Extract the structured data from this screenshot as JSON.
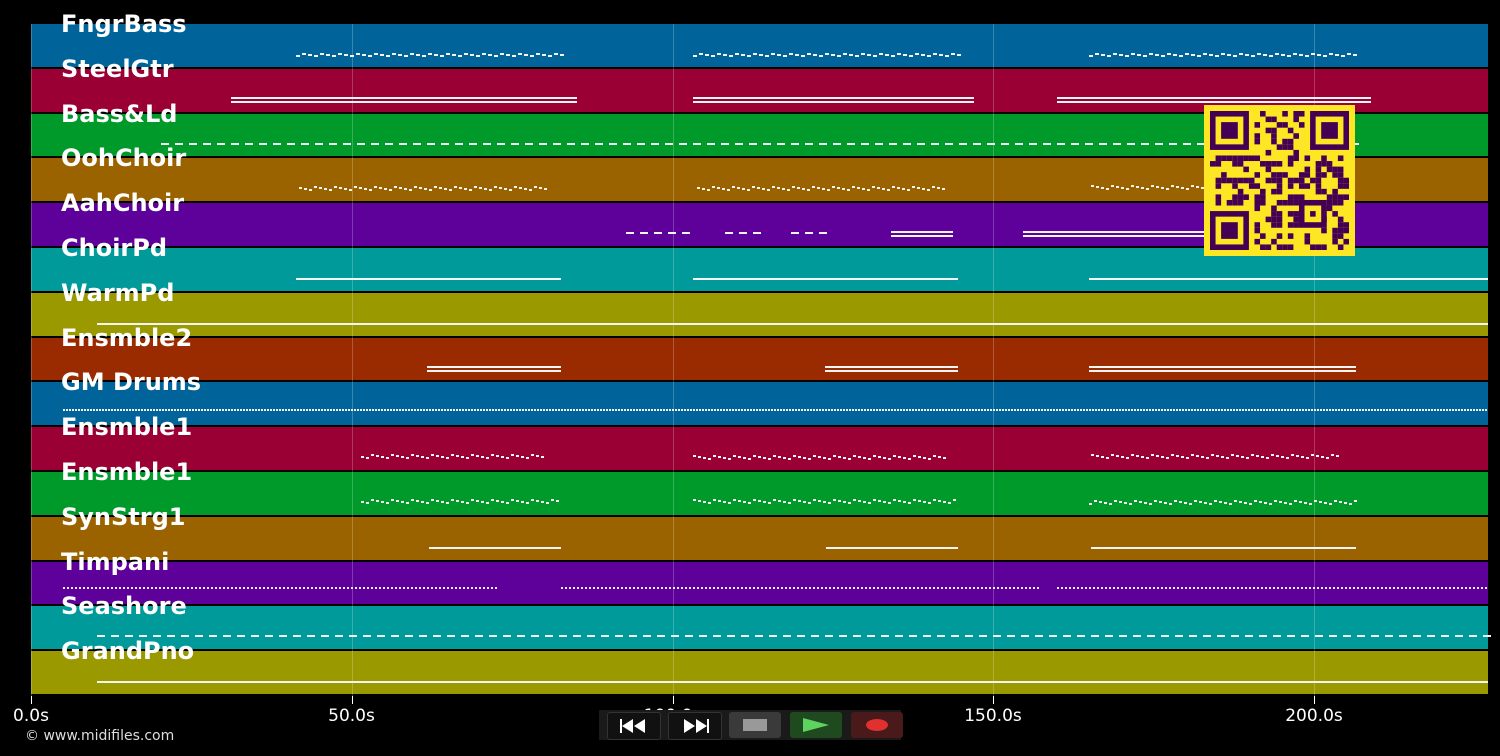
{
  "tracks": [
    {
      "name": "FngrBass",
      "color": "#00639a"
    },
    {
      "name": "SteelGtr",
      "color": "#9a0033"
    },
    {
      "name": "Bass&Ld",
      "color": "#009a2a"
    },
    {
      "name": "OohChoir",
      "color": "#9a6300"
    },
    {
      "name": "AahChoir",
      "color": "#5e009a"
    },
    {
      "name": "ChoirPd",
      "color": "#009a9a"
    },
    {
      "name": "WarmPd",
      "color": "#9a9a00"
    },
    {
      "name": "Ensmble2",
      "color": "#9a2a00"
    },
    {
      "name": "GM Drums",
      "color": "#00639a"
    },
    {
      "name": "Ensmble1",
      "color": "#9a0033"
    },
    {
      "name": "Ensmble1",
      "color": "#009a2a"
    },
    {
      "name": "SynStrg1",
      "color": "#9a6300"
    },
    {
      "name": "Timpani",
      "color": "#5e009a"
    },
    {
      "name": "Seashore",
      "color": "#009a9a"
    },
    {
      "name": "GrandPno",
      "color": "#9a9a00"
    }
  ],
  "timeline": {
    "ticks": [
      "0.0s",
      "50.0s",
      "100.0s",
      "150.0s",
      "200.0s"
    ]
  },
  "copyright": "© www.midifiles.com",
  "transport": {
    "rewind": "rewind-icon",
    "fast_forward": "fast-forward-icon",
    "stop": "stop-icon",
    "play": "play-icon",
    "record": "record-icon"
  },
  "qr_code": {
    "fg": "#440154",
    "bg": "#fde725"
  }
}
